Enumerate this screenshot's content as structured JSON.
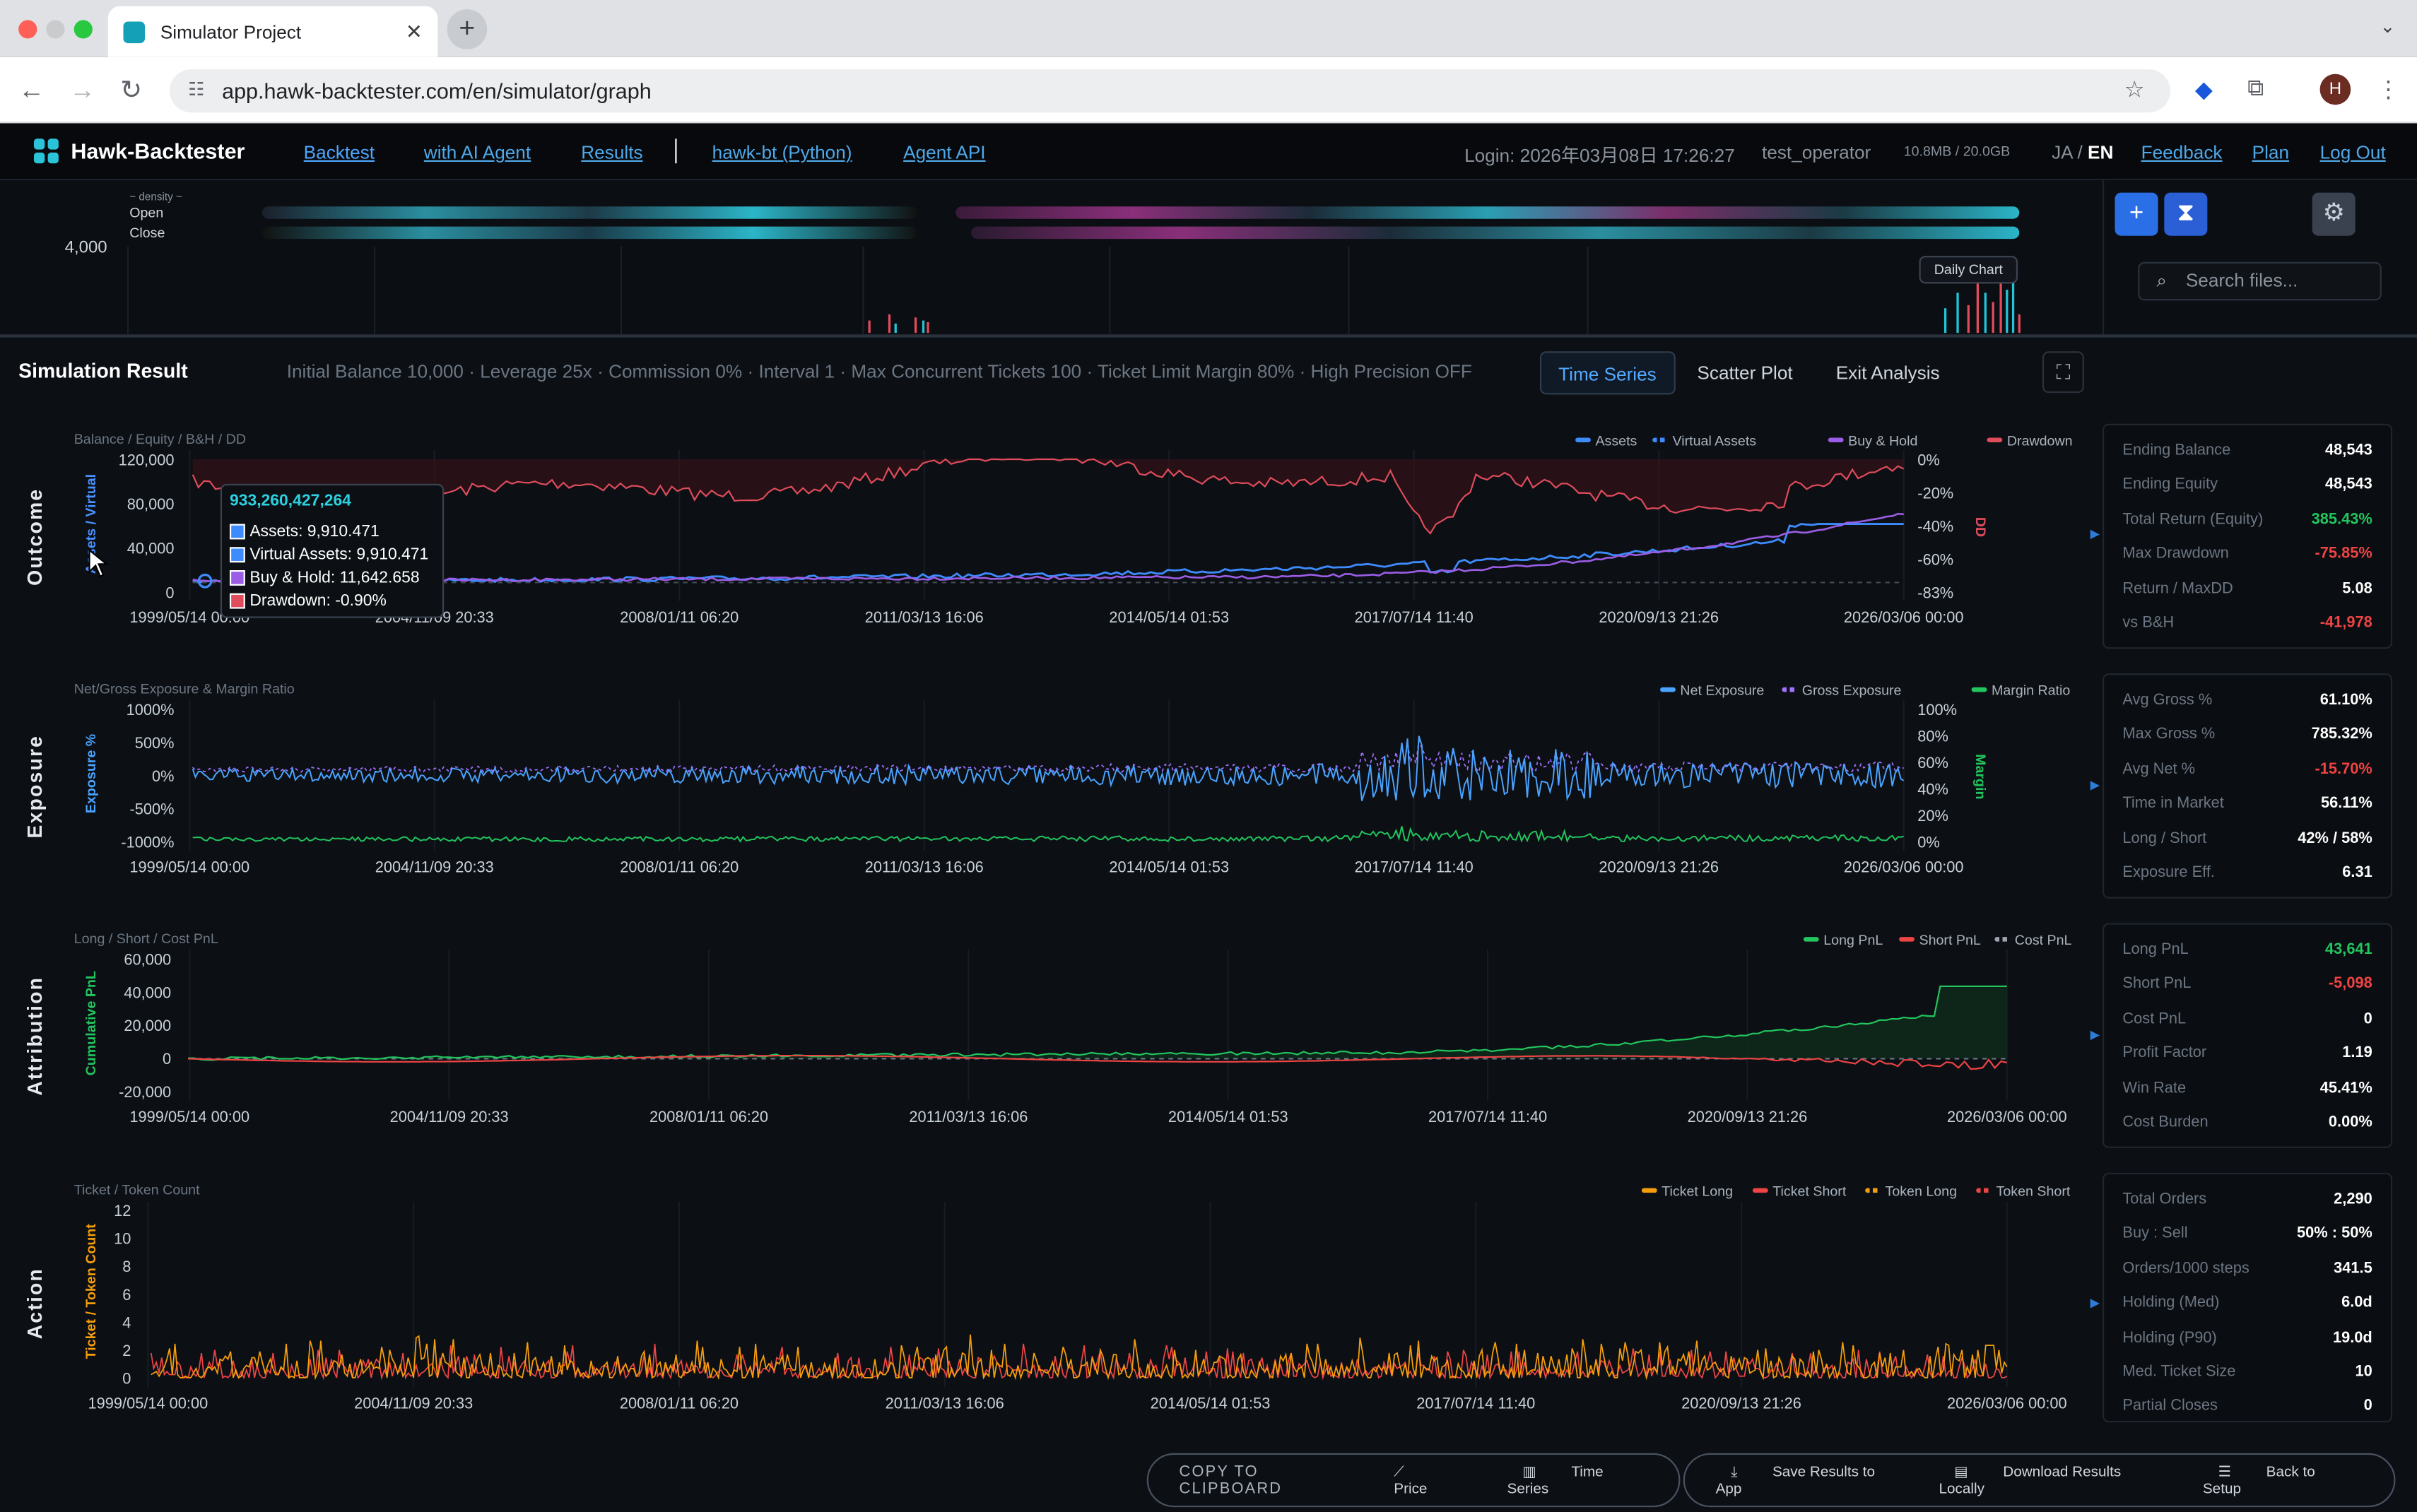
{
  "browser": {
    "tab_title": "Simulator Project",
    "url": "app.hawk-backtester.com/en/simulator/graph",
    "avatar_letter": "H"
  },
  "app": {
    "brand": "Hawk-Backtester",
    "nav": [
      "Backtest",
      "with AI Agent",
      "Results",
      "hawk-bt (Python)",
      "Agent API"
    ],
    "login": "Login: 2026年03月08日 17:26:27",
    "user": "test_operator",
    "storage": "10.8MB / 20.0GB",
    "lang_ja": "JA",
    "lang_sep": "/",
    "lang_en": "EN",
    "links": [
      "Feedback",
      "Plan",
      "Log Out"
    ]
  },
  "upper_chart": {
    "density_label": "~ density ~",
    "open_label": "Open",
    "close_label": "Close",
    "y_value": "4,000",
    "daily_chart_label": "Daily Chart",
    "search_placeholder": "Search files..."
  },
  "panel": {
    "title": "Simulation Result",
    "subtitle": "Initial Balance 10,000 · Leverage 25x · Commission 0% · Interval 1 · Max Concurrent Tickets 100 · Ticket Limit Margin 80% · High Precision OFF",
    "tabs": [
      "Time Series",
      "Scatter Plot",
      "Exit Analysis"
    ],
    "selected_tab": "Time Series"
  },
  "sections": [
    {
      "name": "Outcome",
      "header": "Balance / Equity / B&H / DD",
      "legend": [
        "Assets",
        "Virtual Assets",
        "Buy & Hold",
        "Drawdown"
      ],
      "y_left_label": "Assets / Virtual",
      "y_left_ticks": [
        "120,000",
        "80,000",
        "40,000",
        "0"
      ],
      "y_right_label": "DD",
      "y_right_ticks": [
        "0%",
        "-20%",
        "-40%",
        "-60%",
        "-83%"
      ],
      "x_ticks": [
        "1999/05/14 00:00",
        "2004/11/09 20:33",
        "2008/01/11 06:20",
        "2011/03/13 16:06",
        "2014/05/14 01:53",
        "2017/07/14 11:40",
        "2020/09/13 21:26",
        "2026/03/06 00:00"
      ],
      "stats": [
        [
          "Ending Balance",
          "48,543"
        ],
        [
          "Ending Equity",
          "48,543"
        ],
        [
          "Total Return (Equity)",
          "385.43%"
        ],
        [
          "Max Drawdown",
          "-75.85%"
        ],
        [
          "Return / MaxDD",
          "5.08"
        ],
        [
          "vs B&H",
          "-41,978"
        ]
      ]
    },
    {
      "name": "Exposure",
      "header": "Net/Gross Exposure & Margin Ratio",
      "legend": [
        "Net Exposure",
        "Gross Exposure",
        "Margin Ratio"
      ],
      "y_left_label": "Exposure %",
      "y_left_ticks": [
        "1000%",
        "500%",
        "0%",
        "-500%",
        "-1000%"
      ],
      "y_right_label": "Margin",
      "y_right_ticks": [
        "100%",
        "80%",
        "60%",
        "40%",
        "20%",
        "0%"
      ],
      "x_ticks": [
        "1999/05/14 00:00",
        "2004/11/09 20:33",
        "2008/01/11 06:20",
        "2011/03/13 16:06",
        "2014/05/14 01:53",
        "2017/07/14 11:40",
        "2020/09/13 21:26",
        "2026/03/06 00:00"
      ],
      "stats": [
        [
          "Avg Gross %",
          "61.10%"
        ],
        [
          "Max Gross %",
          "785.32%"
        ],
        [
          "Avg Net %",
          "-15.70%"
        ],
        [
          "Time in Market",
          "56.11%"
        ],
        [
          "Long / Short",
          "42% / 58%"
        ],
        [
          "Exposure Eff.",
          "6.31"
        ]
      ]
    },
    {
      "name": "Attribution",
      "header": "Long / Short / Cost PnL",
      "legend": [
        "Long PnL",
        "Short PnL",
        "Cost PnL"
      ],
      "y_left_label": "Cumulative PnL",
      "y_left_ticks": [
        "60,000",
        "40,000",
        "20,000",
        "0",
        "-20,000"
      ],
      "x_ticks": [
        "1999/05/14 00:00",
        "2004/11/09 20:33",
        "2008/01/11 06:20",
        "2011/03/13 16:06",
        "2014/05/14 01:53",
        "2017/07/14 11:40",
        "2020/09/13 21:26",
        "2026/03/06 00:00"
      ],
      "stats": [
        [
          "Long PnL",
          "43,641"
        ],
        [
          "Short PnL",
          "-5,098"
        ],
        [
          "Cost PnL",
          "0"
        ],
        [
          "Profit Factor",
          "1.19"
        ],
        [
          "Win Rate",
          "45.41%"
        ],
        [
          "Cost Burden",
          "0.00%"
        ]
      ]
    },
    {
      "name": "Action",
      "header": "Ticket / Token Count",
      "legend": [
        "Ticket Long",
        "Ticket Short",
        "Token Long",
        "Token Short"
      ],
      "y_left_label": "Ticket / Token Count",
      "y_left_ticks": [
        "12",
        "10",
        "8",
        "6",
        "4",
        "2",
        "0"
      ],
      "x_ticks": [
        "1999/05/14 00:00",
        "2004/11/09 20:33",
        "2008/01/11 06:20",
        "2011/03/13 16:06",
        "2014/05/14 01:53",
        "2017/07/14 11:40",
        "2020/09/13 21:26",
        "2026/03/06 00:00"
      ],
      "stats": [
        [
          "Total Orders",
          "2,290"
        ],
        [
          "Buy : Sell",
          "50% : 50%"
        ],
        [
          "Orders/1000 steps",
          "341.5"
        ],
        [
          "Holding (Med)",
          "6.0d"
        ],
        [
          "Holding (P90)",
          "19.0d"
        ],
        [
          "Med. Ticket Size",
          "10"
        ],
        [
          "Partial Closes",
          "0"
        ]
      ]
    }
  ],
  "tooltip": {
    "title": "933,260,427,264",
    "assets": "Assets: 9,910.471",
    "virtual": "Virtual Assets: 9,910.471",
    "bh": "Buy & Hold: 11,642.658",
    "dd": "Drawdown: -0.90%"
  },
  "bottom": {
    "copy": "COPY TO CLIPBOARD",
    "price": "Price",
    "time_series": "Time Series",
    "save": "Save Results to App",
    "download": "Download Results Locally",
    "back": "Back to Setup"
  },
  "colors": {
    "assets": "#3d8bfd",
    "virtual": "#3d8bfd",
    "buy_hold": "#9b5de5",
    "drawdown": "#e04c5c",
    "net_exposure": "#4aa3ff",
    "gross_exposure": "#a070ff",
    "margin": "#22c55e",
    "long_pnl": "#22c55e",
    "short_pnl": "#ef4444",
    "cost_pnl": "#9ca3af",
    "ticket_long": "#f59e0b",
    "ticket_short": "#ef4444",
    "positive": "#22c55e",
    "negative": "#ef4444",
    "accent": "#2b7fff"
  }
}
